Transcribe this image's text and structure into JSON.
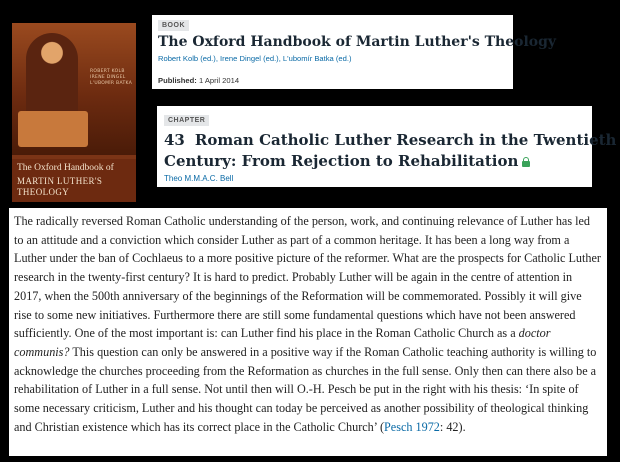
{
  "cover": {
    "editors": [
      "ROBERT KOLB",
      "IRENE DINGEL",
      "L'UBOMÍR BATKA"
    ],
    "title_line1": "The Oxford Handbook of",
    "title_line2": "MARTIN LUTHER'S",
    "title_line3": "THEOLOGY"
  },
  "book": {
    "badge": "BOOK",
    "title": "The Oxford Handbook of Martin Luther's Theology",
    "editors": "Robert Kolb (ed.), Irene Dingel (ed.), L'ubomír Batka (ed.)",
    "published_label": "Published:",
    "published_date": "1 April 2014"
  },
  "chapter": {
    "badge": "CHAPTER",
    "number": "43",
    "title_line1": "Roman Catholic Luther Research in the Twentieth",
    "title_line2": "Century: From Rejection to Rehabilitation",
    "access_icon": "lock-icon",
    "access_color": "#3aa35a",
    "author": "Theo M.M.A.C. Bell"
  },
  "abstract": {
    "text_before_italic": "The radically reversed Roman Catholic understanding of the person, work, and continuing relevance of Luther has led to an attitude and a conviction which consider Luther as part of a common heritage. It has been a long way from a Luther under the ban of Cochlaeus to a more positive picture of the reformer. What are the prospects for Catholic Luther research in the twenty-first century? It is hard to predict. Probably Luther will be again in the centre of attention in 2017, when the 500th anniversary of the beginnings of the Reformation will be commemorated. Possibly it will give rise to some new initiatives. Furthermore there are still some fundamental questions which have not been answered sufficiently. One of the most important is: can Luther find his place in the Roman Catholic Church as a ",
    "italic": "doctor communis?",
    "text_after_italic": " This question can only be answered in a positive way if the Roman Catholic teaching authority is willing to acknowledge the churches proceeding from the Reformation as churches in the full sense. Only then can there also be a rehabilitation of Luther in a full sense. Not until then will O.-H. Pesch be put in the right with his thesis: ‘In spite of some necessary criticism, Luther and his thought can today be perceived as another possibility of theological thinking and Christian existence which has its correct place in the Catholic Church’ (",
    "citation": "Pesch 1972",
    "text_end": ": 42)."
  },
  "colors": {
    "link": "#0a6aa6",
    "title": "#1a2733",
    "background": "#000000"
  }
}
